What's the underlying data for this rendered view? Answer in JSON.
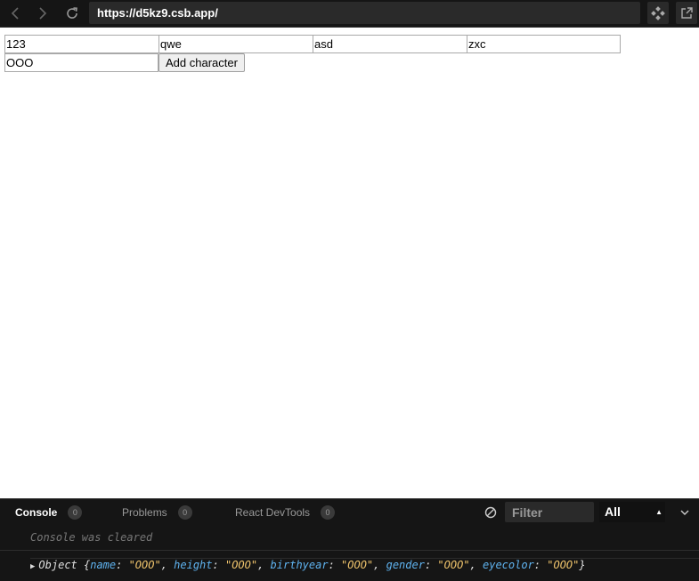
{
  "browser": {
    "url": "https://d5kz9.csb.app/"
  },
  "form": {
    "row1": [
      "123",
      "qwe",
      "asd",
      "zxc"
    ],
    "row2_value": "OOO",
    "add_button_label": "Add character"
  },
  "devtools": {
    "tabs": [
      {
        "label": "Console",
        "count": "0"
      },
      {
        "label": "Problems",
        "count": "0"
      },
      {
        "label": "React DevTools",
        "count": "0"
      }
    ],
    "filter_placeholder": "Filter",
    "level": "All",
    "console_cleared": "Console was cleared",
    "log": {
      "prefix": "Object {",
      "fields": [
        {
          "key": "name",
          "value": "\"OOO\""
        },
        {
          "key": "height",
          "value": "\"OOO\""
        },
        {
          "key": "birthyear",
          "value": "\"OOO\""
        },
        {
          "key": "gender",
          "value": "\"OOO\""
        },
        {
          "key": "eyecolor",
          "value": "\"OOO\""
        }
      ],
      "suffix": "}"
    }
  }
}
